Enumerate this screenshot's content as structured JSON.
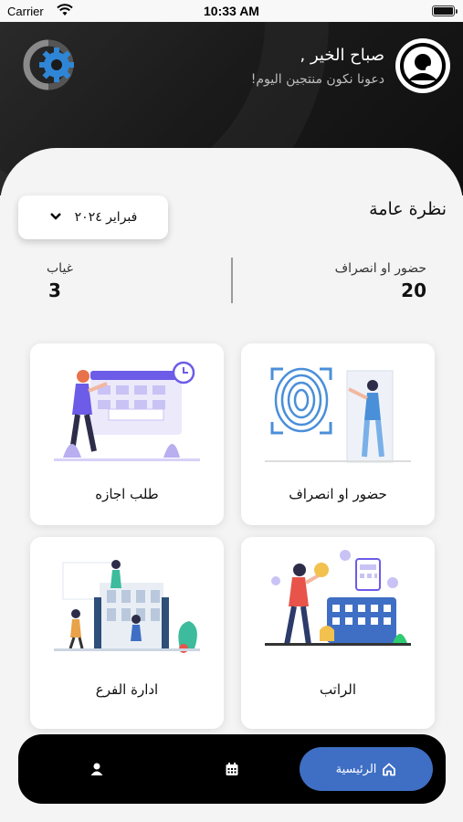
{
  "status_bar": {
    "carrier": "Carrier",
    "time": "10:33 AM"
  },
  "header": {
    "greeting": "صباح الخير ,",
    "subtitle": "دعونا نكون منتجين اليوم!"
  },
  "overview": {
    "title": "نظرة عامة",
    "month": "فبراير ٢٠٢٤",
    "attendance_label": "حضور او انصراف",
    "attendance_value": "20",
    "absence_label": "غياب",
    "absence_value": "3"
  },
  "cards": {
    "attendance": "حضور او انصراف",
    "leave": "طلب اجازه",
    "salary": "الراتب",
    "branch": "ادارة الفرع"
  },
  "nav": {
    "home": "الرئيسية"
  },
  "colors": {
    "accent": "#3f6fc4",
    "header": "#1a1a1a",
    "illustration": "#6c5ce7"
  }
}
